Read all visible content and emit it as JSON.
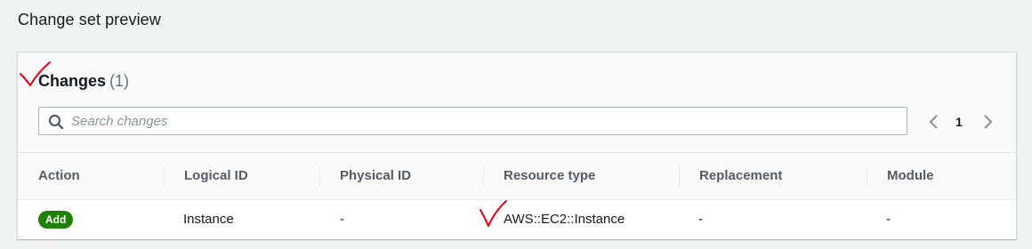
{
  "page": {
    "title": "Change set preview"
  },
  "changes": {
    "heading": "Changes",
    "count": "(1)",
    "search": {
      "placeholder": "Search changes",
      "value": ""
    },
    "pagination": {
      "current_page": "1"
    },
    "columns": [
      "Action",
      "Logical ID",
      "Physical ID",
      "Resource type",
      "Replacement",
      "Module"
    ],
    "rows": [
      {
        "action": "Add",
        "logical_id": "Instance",
        "physical_id": "-",
        "resource_type": "AWS::EC2::Instance",
        "replacement": "-",
        "module": "-"
      }
    ]
  },
  "colors": {
    "add_badge": "#1d8102",
    "annotation_check": "#e3000f"
  },
  "icons": {
    "search": "search-icon",
    "prev": "chevron-left-icon",
    "next": "chevron-right-icon",
    "annotation": "red-checkmark-annotation"
  }
}
